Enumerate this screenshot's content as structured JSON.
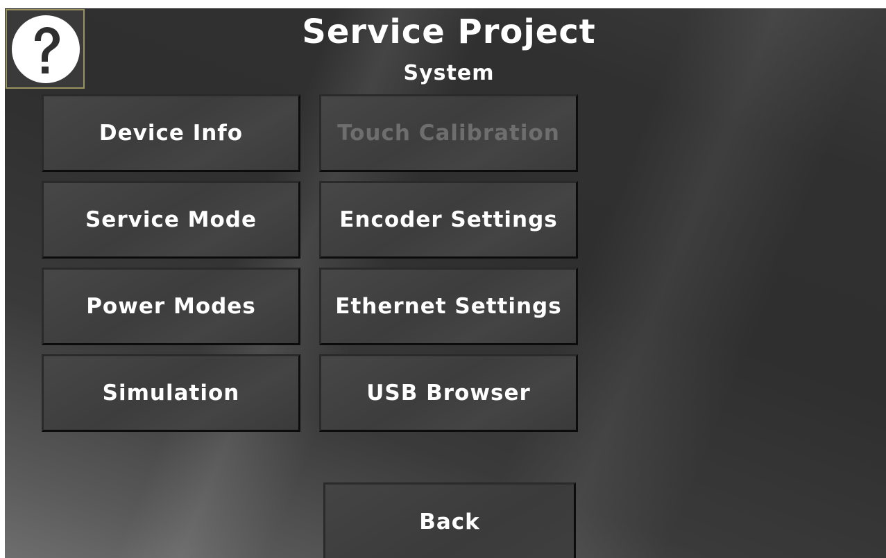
{
  "header": {
    "title": "Service Project",
    "subtitle": "System"
  },
  "help": {
    "icon": "question-mark-icon"
  },
  "menu": {
    "device_info": "Device Info",
    "touch_calibration": "Touch Calibration",
    "service_mode": "Service Mode",
    "encoder_settings": "Encoder Settings",
    "power_modes": "Power Modes",
    "ethernet_settings": "Ethernet Settings",
    "simulation": "Simulation",
    "usb_browser": "USB Browser"
  },
  "footer": {
    "back_label": "Back"
  },
  "colors": {
    "text": "#ffffff",
    "disabled_text": "#6e6e6e",
    "help_border": "#9b9460"
  }
}
